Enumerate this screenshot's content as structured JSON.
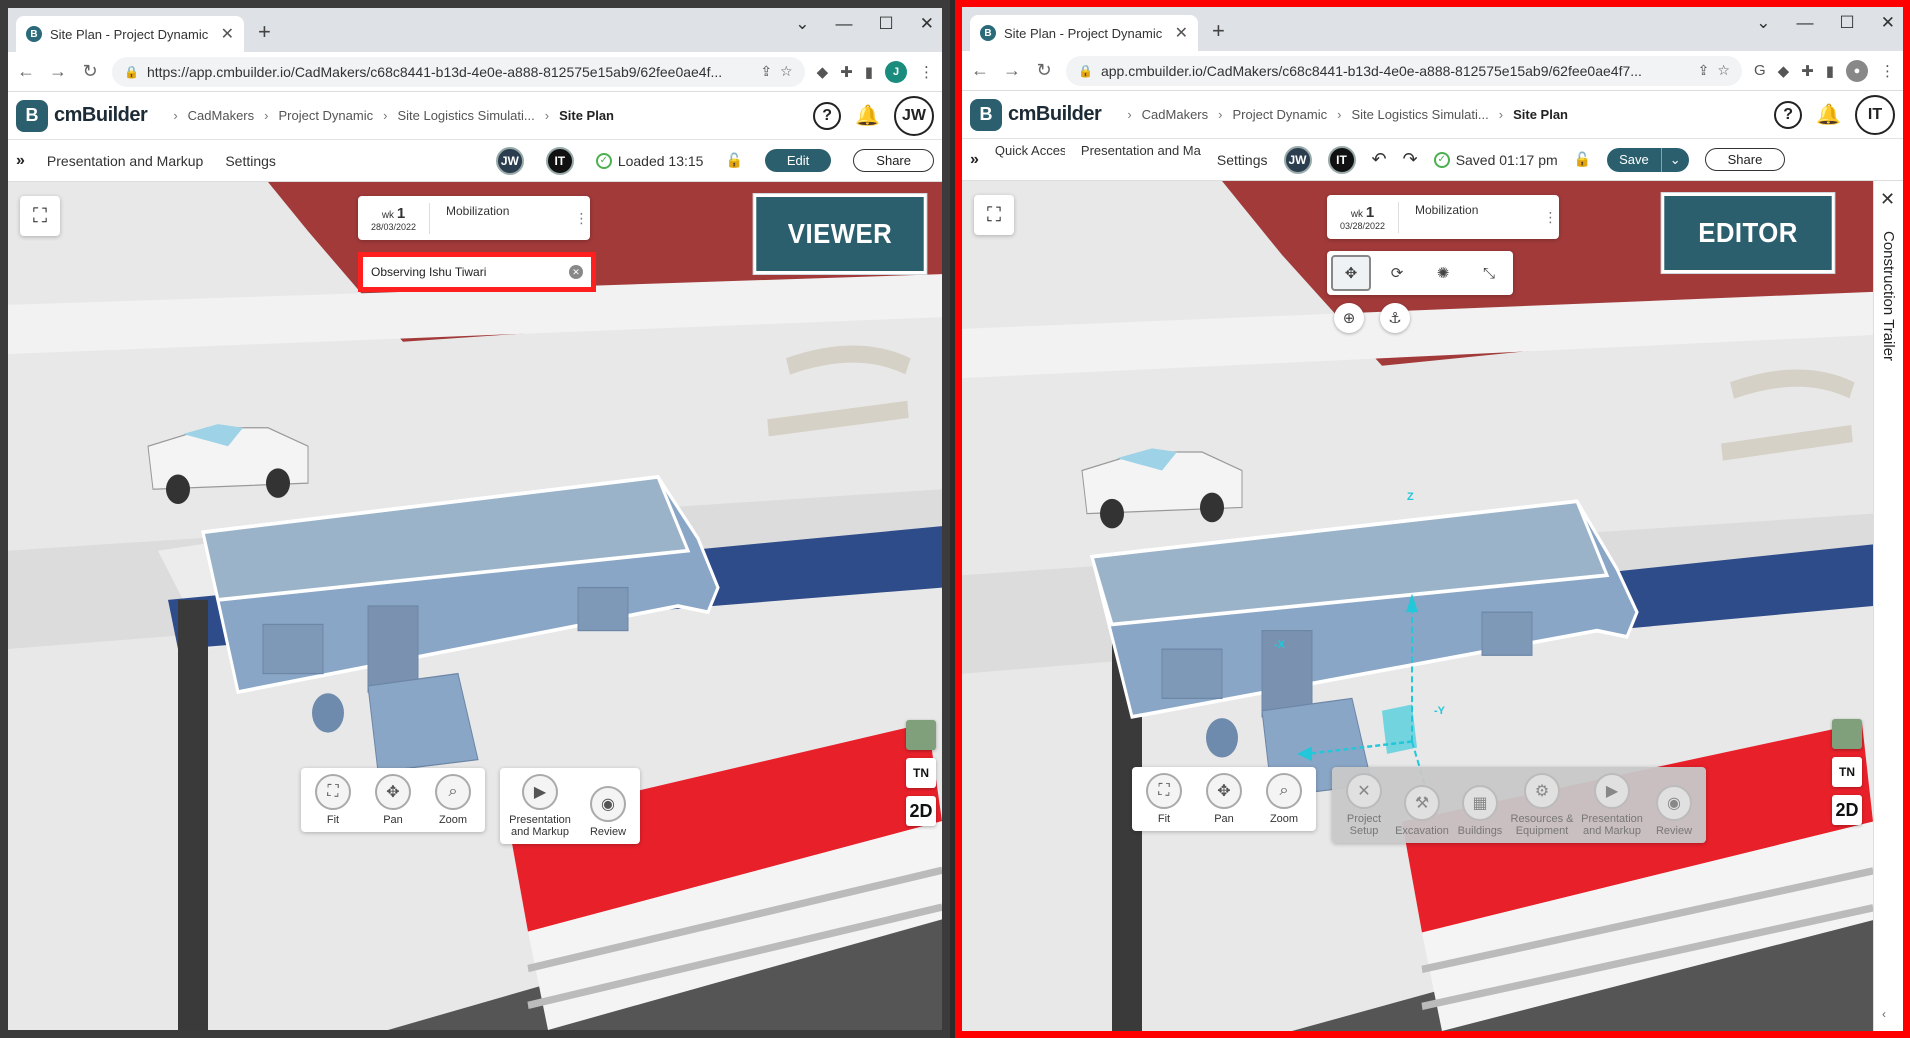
{
  "left": {
    "browser": {
      "tab_title": "Site Plan - Project Dynamic | cmB",
      "url": "https://app.cmbuilder.io/CadMakers/c68c8441-b13d-4e0e-a888-812575e15ab9/62fee0ae4f...",
      "profile": "J"
    },
    "app": {
      "logo_letter": "B",
      "logo_name": "cmBuilder",
      "breadcrumbs": [
        "CadMakers",
        "Project Dynamic",
        "Site Logistics Simulati...",
        "Site Plan"
      ],
      "user_initials": "JW"
    },
    "toolbar": {
      "menu": [
        "Presentation and Markup",
        "Settings"
      ],
      "avatar1": "JW",
      "avatar2": "IT",
      "status": "Loaded 13:15",
      "edit": "Edit",
      "share": "Share"
    },
    "week": {
      "label": "wk",
      "number": "1",
      "date": "28/03/2022",
      "phase": "Mobilization"
    },
    "mode": "VIEWER",
    "observing": "Observing Ishu Tiwari",
    "bottom_tools": [
      {
        "label": "Fit"
      },
      {
        "label": "Pan"
      },
      {
        "label": "Zoom"
      }
    ],
    "bottom_tools2": [
      {
        "label": "Presentation and Markup"
      },
      {
        "label": "Review"
      }
    ],
    "side": {
      "tn": "TN",
      "twod": "2D"
    }
  },
  "right": {
    "browser": {
      "tab_title": "Site Plan - Project Dynamic | cmE",
      "url": "app.cmbuilder.io/CadMakers/c68c8441-b13d-4e0e-a888-812575e15ab9/62fee0ae4f7..."
    },
    "app": {
      "logo_letter": "B",
      "logo_name": "cmBuilder",
      "breadcrumbs": [
        "CadMakers",
        "Project Dynamic",
        "Site Logistics Simulati...",
        "Site Plan"
      ],
      "user_initials": "IT"
    },
    "toolbar": {
      "quick": "Quick Access",
      "pres": "Presentation and Markup",
      "settings": "Settings",
      "avatar1": "JW",
      "avatar2": "IT",
      "status": "Saved 01:17 pm",
      "save": "Save",
      "share": "Share"
    },
    "week": {
      "label": "wk",
      "number": "1",
      "date": "03/28/2022",
      "phase": "Mobilization"
    },
    "mode": "EDITOR",
    "drawer_label": "Construction Trailer",
    "bottom_tools": [
      {
        "label": "Fit"
      },
      {
        "label": "Pan"
      },
      {
        "label": "Zoom"
      }
    ],
    "bottom_tools2": [
      {
        "label": "Project Setup"
      },
      {
        "label": "Excavation"
      },
      {
        "label": "Buildings"
      },
      {
        "label": "Resources & Equipment"
      },
      {
        "label": "Presentation and Markup"
      },
      {
        "label": "Review"
      }
    ],
    "axes": {
      "z": "Z",
      "x": "-X",
      "y": "-Y"
    },
    "side": {
      "tn": "TN",
      "twod": "2D"
    }
  }
}
